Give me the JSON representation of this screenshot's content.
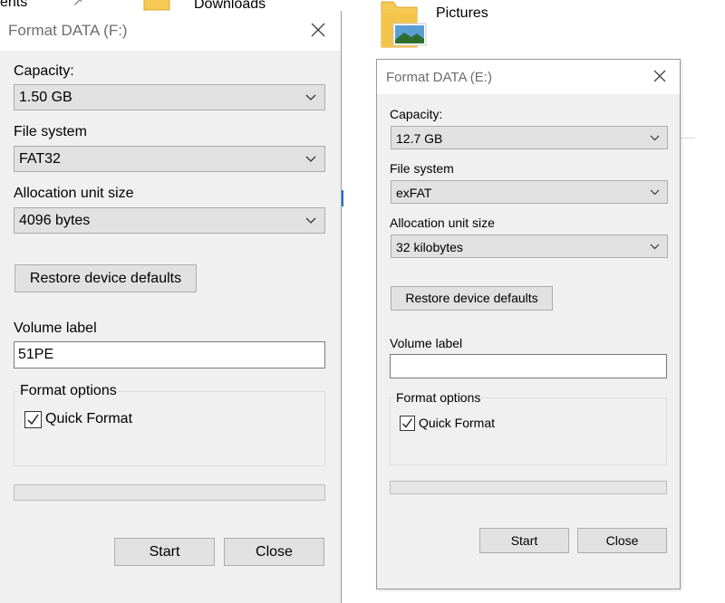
{
  "background": {
    "cut_label": "ents",
    "downloads_label": "Downloads",
    "pictures_label": "Pictures",
    "folder_color": "#f6c955"
  },
  "dialog_f": {
    "title": "Format DATA (F:)",
    "capacity_label": "Capacity:",
    "capacity_value": "1.50 GB",
    "file_system_label": "File system",
    "file_system_value": "FAT32",
    "allocation_label": "Allocation unit size",
    "allocation_value": "4096 bytes",
    "restore_label": "Restore device defaults",
    "volume_label_label": "Volume label",
    "volume_label_value": "51PE",
    "format_options_label": "Format options",
    "quick_format_label": "Quick Format",
    "quick_format_checked": true,
    "progress": 0,
    "start_label": "Start",
    "close_label": "Close"
  },
  "dialog_e": {
    "title": "Format DATA (E:)",
    "capacity_label": "Capacity:",
    "capacity_value": "12.7 GB",
    "file_system_label": "File system",
    "file_system_value": "exFAT",
    "allocation_label": "Allocation unit size",
    "allocation_value": "32 kilobytes",
    "restore_label": "Restore device defaults",
    "volume_label_label": "Volume label",
    "volume_label_value": "",
    "format_options_label": "Format options",
    "quick_format_label": "Quick Format",
    "quick_format_checked": true,
    "progress": 0,
    "start_label": "Start",
    "close_label": "Close"
  },
  "colors": {
    "dialog_bg": "#f0f0f0",
    "button_bg": "#e1e1e1",
    "title_text": "#6d6d6d"
  }
}
